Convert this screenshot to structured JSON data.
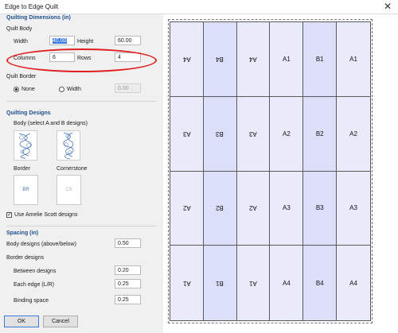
{
  "window": {
    "title": "Edge to Edge Quilt",
    "close_glyph": "✕"
  },
  "dimensions": {
    "header": "Quilting Dimensions (in)",
    "body_header": "Quilt Body",
    "width_label": "Width",
    "width_value": "40.00",
    "height_label": "Height",
    "height_value": "60.00",
    "columns_label": "Columns",
    "columns_value": "6",
    "rows_label": "Rows",
    "rows_value": "4"
  },
  "border": {
    "header": "Quilt Border",
    "none_label": "None",
    "width_label": "Width",
    "width_value": "0.00",
    "selected": "None"
  },
  "designs": {
    "header": "Quilting Designs",
    "body_label": "Body (select A and B designs)",
    "border_label": "Border",
    "cornerstone_label": "Cornerstone",
    "border_button": "BR",
    "cornerstone_button": "CS",
    "use_amelie_label": "Use Amelie Scott designs",
    "use_amelie_checked": true
  },
  "spacing": {
    "header": "Spacing (in)",
    "body_designs_label": "Body designs (above/below)",
    "body_designs_value": "0.50",
    "border_designs_label": "Border designs",
    "between_label": "Between designs",
    "between_value": "0.20",
    "each_edge_label": "Each edge (L/R)",
    "each_edge_value": "0.25",
    "binding_label": "Binding space",
    "binding_value": "0.25"
  },
  "buttons": {
    "ok": "OK",
    "cancel": "Cancel"
  },
  "colors": {
    "cell_a": "#e9ebfb",
    "cell_b": "#dcdff8",
    "annotation": "#e02020",
    "header": "#1f4e8c"
  },
  "grid": {
    "rows": [
      [
        {
          "t": "A4",
          "up": true,
          "k": "a"
        },
        {
          "t": "B4",
          "up": true,
          "k": "b"
        },
        {
          "t": "A4",
          "up": true,
          "k": "a"
        },
        {
          "t": "A1",
          "up": false,
          "k": "a"
        },
        {
          "t": "B1",
          "up": false,
          "k": "b"
        },
        {
          "t": "A1",
          "up": false,
          "k": "a"
        }
      ],
      [
        {
          "t": "A3",
          "up": true,
          "k": "a"
        },
        {
          "t": "B3",
          "up": true,
          "k": "b"
        },
        {
          "t": "A3",
          "up": true,
          "k": "a"
        },
        {
          "t": "A2",
          "up": false,
          "k": "a"
        },
        {
          "t": "B2",
          "up": false,
          "k": "b"
        },
        {
          "t": "A2",
          "up": false,
          "k": "a"
        }
      ],
      [
        {
          "t": "A2",
          "up": true,
          "k": "a"
        },
        {
          "t": "B2",
          "up": true,
          "k": "b"
        },
        {
          "t": "A2",
          "up": true,
          "k": "a"
        },
        {
          "t": "A3",
          "up": false,
          "k": "a"
        },
        {
          "t": "B3",
          "up": false,
          "k": "b"
        },
        {
          "t": "A3",
          "up": false,
          "k": "a"
        }
      ],
      [
        {
          "t": "A1",
          "up": true,
          "k": "a"
        },
        {
          "t": "B1",
          "up": true,
          "k": "b"
        },
        {
          "t": "A1",
          "up": true,
          "k": "a"
        },
        {
          "t": "A4",
          "up": false,
          "k": "a"
        },
        {
          "t": "B4",
          "up": false,
          "k": "b"
        },
        {
          "t": "A4",
          "up": false,
          "k": "a"
        }
      ]
    ]
  }
}
